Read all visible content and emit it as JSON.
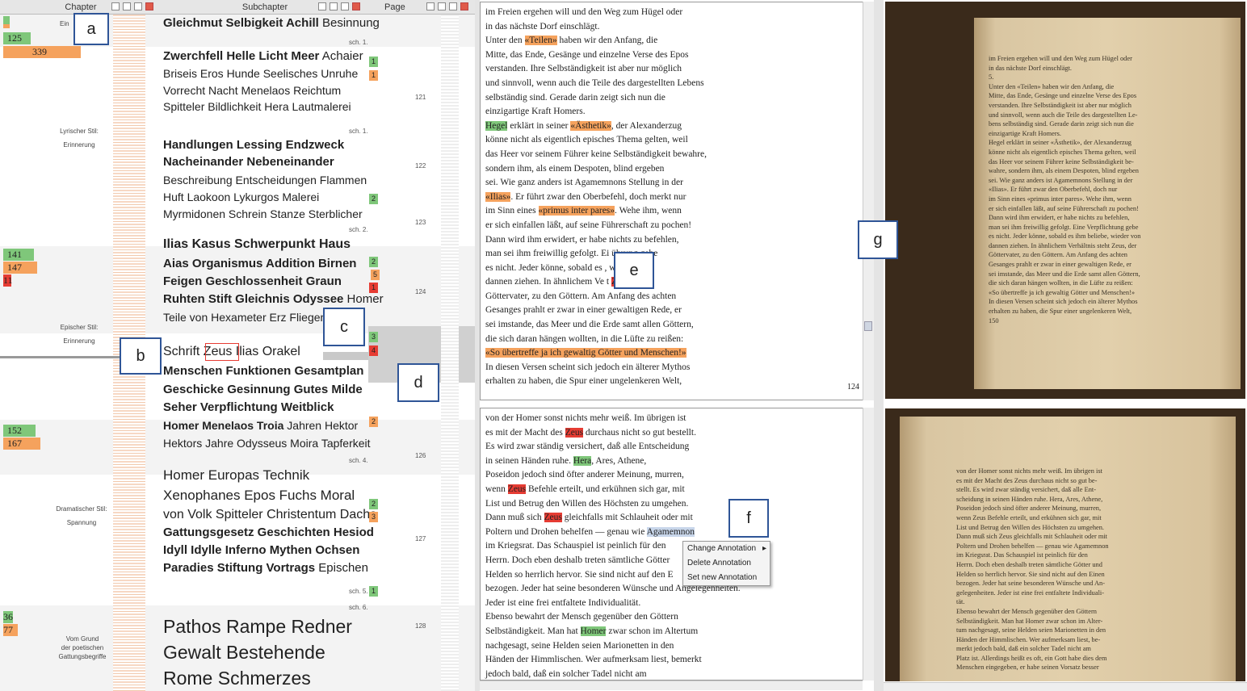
{
  "headers": {
    "chapter": "Chapter",
    "subchapter": "Subchapter",
    "page": "Page"
  },
  "labels": {
    "a": "a",
    "b": "b",
    "c": "c",
    "d": "d",
    "e": "e",
    "f": "f",
    "g": "g"
  },
  "chapter_tags": [
    "125",
    "339",
    "141",
    "147",
    "11",
    "152",
    "167",
    "36",
    "77"
  ],
  "chapters": [
    {
      "l1": "Ein",
      "l2": ""
    },
    {
      "l1": "Lyrischer Stil:",
      "l2": "Erinnerung"
    },
    {
      "l1": "Epischer Stil:",
      "l2": "Erinnerung"
    },
    {
      "l1": "Dramatischer Stil:",
      "l2": "Spannung"
    },
    {
      "l1": "Vom Grund",
      "l2": "der poetischen",
      "l3": "Gattungsbegriffe"
    }
  ],
  "sub_lines": [
    {
      "bold": "Gleichmut Selbigkeit Achill",
      "rest": " Besinnung"
    },
    {
      "bold": "Zwerchfell Helle Licht Meer",
      "rest": " Achaier"
    },
    {
      "bold": "",
      "rest": "Briseis Eros Hunde Seelisches Unruhe"
    },
    {
      "bold": "",
      "rest": "Vorrecht Nacht Menelaos Reichtum"
    },
    {
      "bold": "",
      "rest": "Spitteler Bildlichkeit Hera Lautmalerei"
    },
    {
      "bold": "Handlungen Lessing Endzweck",
      "rest": ""
    },
    {
      "bold": "Nacheinander Nebeneinander",
      "rest": ""
    },
    {
      "bold": "",
      "rest": "Beschreibung Entscheidungen Flammen"
    },
    {
      "bold": "",
      "rest": "Huft Laokoon Lykurgos Malerei"
    },
    {
      "bold": "",
      "rest": "Myrmidonen Schrein Stanze Sterblicher"
    },
    {
      "bold": "Ilias Kasus Schwerpunkt Haus",
      "rest": ""
    },
    {
      "bold": "Aias Organismus Addition Birnen",
      "rest": ""
    },
    {
      "bold": "Feigen Geschlossenheit Graun",
      "rest": ""
    },
    {
      "bold": "Ruhten Stift Gleichnis Odyssee",
      "rest": " Homer"
    },
    {
      "bold": "",
      "rest": "Teile von Hexameter Erz Fliegen R"
    },
    {
      "bold": "",
      "rest": "Schrift Zeus Ilias Orakel"
    },
    {
      "bold": "Menschen Funktionen Gesamtplan",
      "rest": ""
    },
    {
      "bold": "Geschicke Gesinnung Gutes Milde",
      "rest": ""
    },
    {
      "bold": "Seher Verpflichtung Weitblick",
      "rest": ""
    },
    {
      "bold": "Homer Menelaos Troia",
      "rest": " Jahren Hektor"
    },
    {
      "bold": "",
      "rest": "Hektors Jahre Odysseus Moira Tapferkeit"
    },
    {
      "bold": "",
      "rest": "Homer Europas Technik"
    },
    {
      "bold": "",
      "rest": "Xenophanes Epos Fuchs Moral"
    },
    {
      "bold": "",
      "rest": "von Volk Spitteler Christentum Dachs"
    },
    {
      "bold": "Gattungsgesetz Geschichten Hesiod",
      "rest": ""
    },
    {
      "bold": "Idyll Idylle Inferno Mythen Ochsen",
      "rest": ""
    },
    {
      "bold": "Paradies Stiftung Vortrags",
      "rest": " Epischen"
    },
    {
      "bold": "",
      "rest": "Pathos Rampe Redner"
    },
    {
      "bold": "",
      "rest": "Gewalt Bestehende"
    },
    {
      "bold": "",
      "rest": "Rome Schmerzes"
    }
  ],
  "sch_labels": [
    "sch. 1.",
    "sch. 1.",
    "sch. 2.",
    "sch. 4.",
    "sch. 5.",
    "sch. 6."
  ],
  "page_numbers": [
    "121",
    "122",
    "123",
    "124",
    "126",
    "127",
    "128"
  ],
  "page_marks": [
    "1",
    "1",
    "2",
    "2",
    "5",
    "1",
    "3",
    "4",
    "2",
    "2",
    "3",
    "1"
  ],
  "text_top": [
    [
      {
        "t": "im Freien ergehen will und den Weg zum Hügel oder"
      }
    ],
    [
      {
        "t": "in das nächste Dorf einschlägt."
      }
    ],
    [
      {
        "t": "     Unter den "
      },
      {
        "t": "«Teilen»",
        "c": "ho"
      },
      {
        "t": " haben wir den Anfang, die"
      }
    ],
    [
      {
        "t": "Mitte, das Ende, Gesänge und einzelne Verse des Epos"
      }
    ],
    [
      {
        "t": "verstanden. Ihre Selbständigkeit ist aber nur möglich"
      }
    ],
    [
      {
        "t": "und sinnvoll, wenn auch die Teile des dargestellten Lebens"
      }
    ],
    [
      {
        "t": "selbständig sind. Gerade darin zeigt sich nun die"
      }
    ],
    [
      {
        "t": "einzigartige Kraft Homers."
      }
    ],
    [
      {
        "t": "     "
      },
      {
        "t": "Hegel",
        "c": "hg"
      },
      {
        "t": " erklärt in seiner "
      },
      {
        "t": "«Ästhetik»",
        "c": "ho"
      },
      {
        "t": ", der Alexanderzug"
      }
    ],
    [
      {
        "t": "könne nicht als eigentlich episches Thema gelten, weil"
      }
    ],
    [
      {
        "t": "das Heer vor seinem Führer keine Selbständigkeit bewahre,"
      }
    ],
    [
      {
        "t": "sondern ihm, als einem Despoten, blind ergeben"
      }
    ],
    [
      {
        "t": "sei. Wie ganz anders ist Agamemnons Stellung in der"
      }
    ],
    [
      {
        "t": "«Ilias»",
        "c": "ho"
      },
      {
        "t": ". Er führt zwar den Oberbefehl, doch merkt nur"
      }
    ],
    [
      {
        "t": "im Sinn eines "
      },
      {
        "t": "«primus inter pares»",
        "c": "ho"
      },
      {
        "t": ". Wehe ihm, wenn"
      }
    ],
    [
      {
        "t": "er sich einfallen läßt, auf seine Führerschaft zu pochen!"
      }
    ],
    [
      {
        "t": "Dann wird ihm erwidert, er habe nichts zu befehlen,"
      }
    ],
    [
      {
        "t": "man sei ihm freiwillig gefolgt. Ei             ührung gebe"
      }
    ],
    [
      {
        "t": "es nicht. Jeder könne, sobald es              , wieder von"
      }
    ],
    [
      {
        "t": "dannen ziehen. In ähnlichem Ve               t "
      },
      {
        "t": "Zeus",
        "c": "hr"
      },
      {
        "t": ", der"
      }
    ],
    [
      {
        "t": "Göttervater, zu den Göttern. Am Anfang des achten"
      }
    ],
    [
      {
        "t": "Gesanges prahlt er zwar in einer gewaltigen Rede, er"
      }
    ],
    [
      {
        "t": "sei imstande, das Meer und die Erde samt allen Göttern,"
      }
    ],
    [
      {
        "t": "die sich daran hängen wollten, in die Lüfte zu reißen:"
      }
    ],
    [
      {
        "t": "     "
      },
      {
        "t": "«So übertreffe ja ich gewaltig Götter und Menschen!»",
        "c": "ho"
      }
    ],
    [
      {
        "t": "     In diesen Versen scheint sich jedoch ein älterer Mythos"
      }
    ],
    [
      {
        "t": "erhalten zu haben, die Spur einer ungelenkeren Welt,"
      }
    ]
  ],
  "page_top_number": "124",
  "text_bottom": [
    [
      {
        "t": "von der Homer sonst nichts mehr weiß. Im übrigen ist"
      }
    ],
    [
      {
        "t": "es mit der Macht des "
      },
      {
        "t": "Zeus",
        "c": "hr"
      },
      {
        "t": " durchaus nicht so gut bestellt."
      }
    ],
    [
      {
        "t": "Es wird zwar ständig versichert, daß alle Entscheidung"
      }
    ],
    [
      {
        "t": "in seinen Händen ruhe. "
      },
      {
        "t": "Hera",
        "c": "hg"
      },
      {
        "t": ", Ares, Athene,"
      }
    ],
    [
      {
        "t": "Poseidon jedoch sind öfter anderer Meinung, murren,"
      }
    ],
    [
      {
        "t": "wenn "
      },
      {
        "t": "Zeus",
        "c": "hr"
      },
      {
        "t": " Befehle erteilt, und erkühnen sich gar, mit"
      }
    ],
    [
      {
        "t": "List und Betrug den Willen des Höchsten zu umgehen."
      }
    ],
    [
      {
        "t": "Dann muß sich "
      },
      {
        "t": "Zeus",
        "c": "hr"
      },
      {
        "t": " gleichfalls mit Schlauheit oder mit"
      }
    ],
    [
      {
        "t": "Poltern und Drohen behelfen — genau wie "
      },
      {
        "t": "Agamemnon",
        "c": "hb"
      }
    ],
    [
      {
        "t": "im Kriegsrat. Das Schauspiel ist peinlich für den"
      }
    ],
    [
      {
        "t": "Herrn. Doch eben deshalb treten sämtliche Götter"
      }
    ],
    [
      {
        "t": "Helden so herrlich hervor. Sie sind nicht auf den E"
      }
    ],
    [
      {
        "t": "bezogen. Jeder hat seine besonderen Wünsche und Angelegenheiten."
      }
    ],
    [
      {
        "t": "Jeder ist eine frei entfaltete Individualität."
      }
    ],
    [
      {
        "t": "     Ebenso bewahrt der Mensch gegenüber den Göttern"
      }
    ],
    [
      {
        "t": "Selbständigkeit. Man hat "
      },
      {
        "t": "Homer",
        "c": "hg"
      },
      {
        "t": " zwar schon im Altertum"
      }
    ],
    [
      {
        "t": "nachgesagt, seine Helden seien Marionetten in den"
      }
    ],
    [
      {
        "t": "Händen der Himmlischen. Wer aufmerksam liest, bemerkt"
      }
    ],
    [
      {
        "t": "jedoch bald, daß ein solcher Tadel nicht am"
      }
    ]
  ],
  "context_menu": [
    "Change Annotation",
    "Delete Annotation",
    "Set new Annotation"
  ],
  "scan_top": [
    "im Freien ergehen will und den Weg zum Hügel oder",
    "in das nächste Dorf einschlägt.",
    "5.",
    "Unter den «Teilen» haben wir den Anfang, die",
    "Mitte, das Ende, Gesänge und einzelne Verse des Epos",
    "verstanden. Ihre Selbständigkeit ist aber nur möglich",
    "und sinnvoll, wenn auch die Teile des dargestellten Le-",
    "bens selbständig sind. Gerade darin zeigt sich nun die",
    "einzigartige Kraft Homers.",
    "Hegel erklärt in seiner «Ästhetik», der Alexanderzug",
    "könne nicht als eigentlich episches Thema gelten, weil",
    "das Heer vor seinem Führer keine Selbständigkeit be-",
    "wahre, sondern ihm, als einem Despoten, blind ergeben",
    "sei. Wie ganz anders ist Agamemnons Stellung in der",
    "«Ilias». Er führt zwar den Oberbefehl, doch nur",
    "im Sinn eines «primus inter pares». Wehe ihm, wenn",
    "er sich einfallen läßt, auf seine Führerschaft zu pochen!",
    "Dann wird ihm erwidert, er habe nichts zu befehlen,",
    "man sei ihm freiwillig gefolgt. Eine Verpflichtung gebe",
    "es nicht. Jeder könne, sobald es ihm beliebe, wieder von",
    "dannen ziehen. In ähnlichem Verhältnis steht Zeus, der",
    "Göttervater, zu den Göttern. Am Anfang des achten",
    "Gesanges prahlt er zwar in einer gewaltigen Rede, er",
    "sei imstande, das Meer und die Erde samt allen Göttern,",
    "die sich daran hängen wollten, in die Lüfte zu reißen:",
    "«So übertreffe ja ich gewaltig Götter und Menschen!»",
    "In diesen Versen scheint sich jedoch ein älterer Mythos",
    "erhalten zu haben, die Spur einer ungelenkeren Welt,",
    "150"
  ],
  "scan_bottom": [
    "von der Homer sonst nichts mehr weiß. Im übrigen ist",
    "es mit der Macht des Zeus durchaus nicht so gut be-",
    "stellt. Es wird zwar ständig versichert, daß alle Ent-",
    "scheidung in seinen Händen ruhe. Hera, Ares, Athene,",
    "Poseidon jedoch sind öfter anderer Meinung, murren,",
    "wenn Zeus Befehle erteilt, und erkühnen sich gar, mit",
    "List und Betrug den Willen des Höchsten zu umgehen.",
    "Dann muß sich Zeus gleichfalls mit Schlauheit oder mit",
    "Poltern und Drohen behelfen — genau wie Agamemnon",
    "im Kriegsrat. Das Schauspiel ist peinlich für den",
    "Herrn. Doch eben deshalb treten sämtliche Götter und",
    "Helden so herrlich hervor. Sie sind nicht auf den Einen",
    "bezogen. Jeder hat seine besonderen Wünsche und An-",
    "gelegenheiten. Jeder ist eine frei entfaltete Individuali-",
    "tät.",
    "Ebenso bewahrt der Mensch gegenüber den Göttern",
    "Selbständigkeit. Man hat Homer zwar schon im Alter-",
    "tum nachgesagt, seine Helden seien Marionetten in den",
    "Händen der Himmlischen. Wer aufmerksam liest, be-",
    "merkt jedoch bald, daß ein solcher Tadel nicht am",
    "Platz ist. Allerdings heißt es oft, ein Gott habe dies dem",
    "Menschen eingegeben, er habe seinen Vorsatz besser"
  ],
  "colors": {
    "green": "#7fc77a",
    "orange": "#f5a25d",
    "red": "#e63c33",
    "label_border": "#2f5597"
  }
}
